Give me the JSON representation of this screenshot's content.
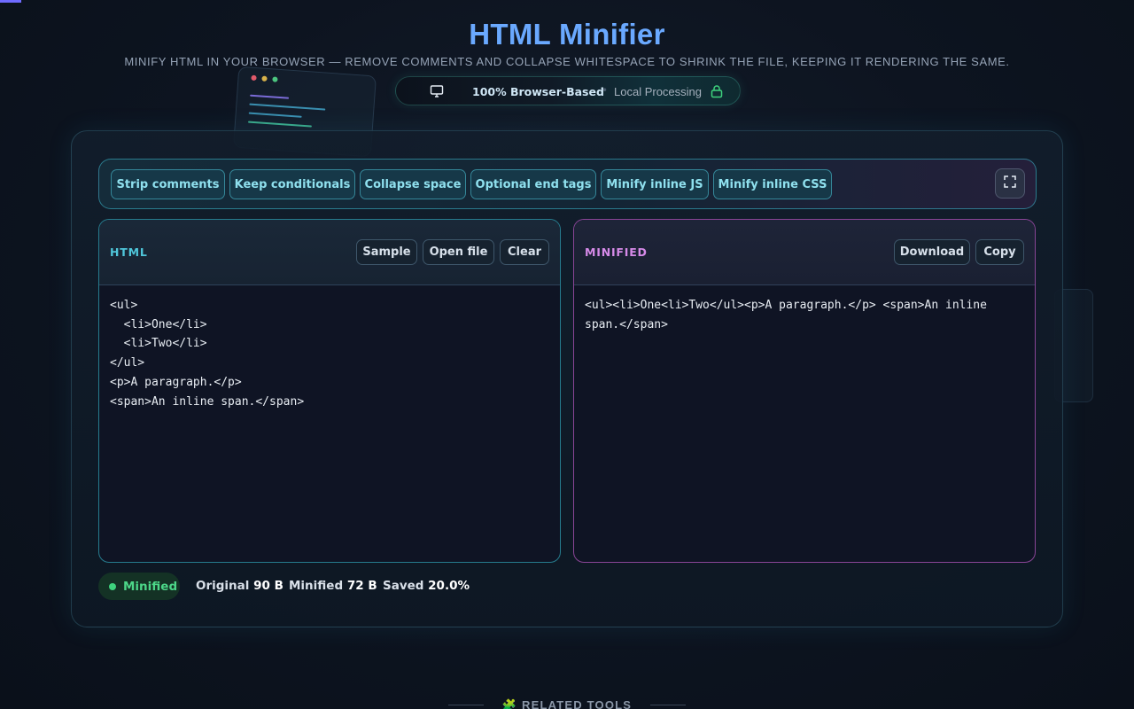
{
  "header": {
    "title": "HTML Minifier",
    "subtitle": "MINIFY HTML IN YOUR BROWSER — REMOVE COMMENTS AND COLLAPSE WHITESPACE TO SHRINK THE FILE, KEEPING IT RENDERING THE SAME.",
    "badge": {
      "icon": "monitor-icon",
      "strong_text": "100% Browser-Based",
      "separator": "•",
      "secondary_text": "Local Processing",
      "secondary_icon": "lock-icon"
    }
  },
  "toolbar": {
    "options": [
      {
        "label": "Strip comments"
      },
      {
        "label": "Keep conditionals"
      },
      {
        "label": "Collapse space"
      },
      {
        "label": "Optional end tags"
      },
      {
        "label": "Minify inline JS"
      },
      {
        "label": "Minify inline CSS"
      }
    ],
    "expand_icon": "expand-icon"
  },
  "input_pane": {
    "label": "HTML",
    "buttons": {
      "sample": "Sample",
      "open_file": "Open file",
      "clear": "Clear"
    },
    "value": "<ul>\n  <li>One</li>\n  <li>Two</li>\n</ul>\n<p>A paragraph.</p>\n<span>An inline span.</span>"
  },
  "output_pane": {
    "label": "MINIFIED",
    "buttons": {
      "download": "Download",
      "copy": "Copy"
    },
    "value": "<ul><li>One<li>Two</ul><p>A paragraph.</p> <span>An inline span.</span>"
  },
  "status": {
    "state": "Minified",
    "original_label": "Original",
    "original_value": "90 B",
    "minified_label": "Minified",
    "minified_value": "72 B",
    "saved_label": "Saved",
    "saved_value": "20.0%"
  },
  "related": {
    "icon": "puzzle-icon",
    "glyph": "🧩",
    "label": "RELATED TOOLS"
  },
  "colors": {
    "title": "#6aa9ff",
    "accent_cyan": "#35c6d8",
    "accent_magenta": "#d68ae8",
    "success_green": "#3ed27d"
  }
}
